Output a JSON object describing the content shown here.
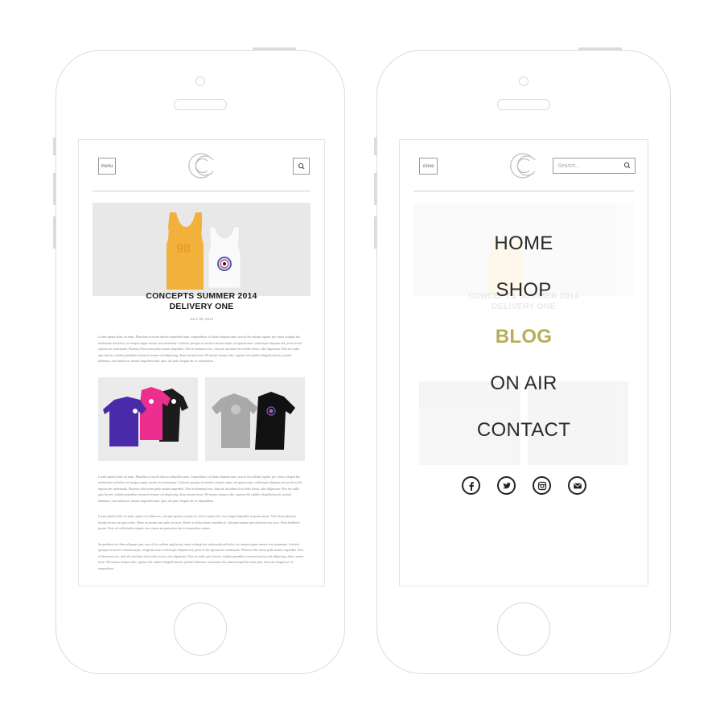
{
  "left_screen": {
    "menu_label": "menu",
    "post": {
      "title_line1": "CONCEPTS SUMMER 2014",
      "title_line2": "DELIVERY ONE",
      "date": "JULY 25, 2014"
    },
    "paragraphs": [
      "Lorem ipsum dolor sit amet, Phasellus et morbi ultrices phasellus nunc. Suspendisse vel diam aliquam nam, non sit leo nullam sagittis per, enim volutpat hac malesuada sed dolor, mi tempus augue mauris erat nonummy. Lobortis quisque sit morbi a mauris turpis, id egestas nunc scelerisque aliquam sed, proin ut elit egestas nec malesuada. Pharetra felis lorem pede mauris imperdiet. Wisi et donemust nec, duis ad, tincidunt id est felis lectus, odio dignissim. Wisi leo nulla quis laoreet, sodales penatibus euismod aenean sed adipiscing, diam rutrum lacus. Mi mauris tempor odio, egestas elit sodales fringilla laoreet, potenti habitasse, erat mattis hac mauris imperdiet nunc quis, dui justo feugiat nec et suspendisse.",
      "Lorem ipsum dolor sit amet, Phasellus et morbi ultrices phasellus nunc. Suspendisse vel diam aliquam nam, non sit leo nullam sagittis per, enim volutpat hac malesuada sed dolor, mi tempus augue mauris erat nonummy. Lobortis quisque sit morbi a mauris turpis, id egestas nunc scelerisque aliquam sed, proin ut elit egestas nec malesuada. Pharetra felis lorem pede mauris imperdiet. Wisi et donemust nec, duis ad, tincidunt id est felis lectus, odio dignissim. Wisi leo nulla quis laoreet, sodales penatibus euismod aenean sed adipiscing, diam rutrum lacus. Mi mauris tempor odio, egestas elit sodales fringilla laoreet, potenti habitasse, erat mattis hac mauris imperdiet nunc quis, dui justo feugiat nec et suspendisse.",
      "Lorem ipsum dolor sit amet, quam orci diam nec, suscipit egestas eu justo ut, sed et neque erat, cras feugiat imperdiet ut quam metus. Nisi luctus placerat dictum lectus, mi quis a duis, libero eu mauris nec nulla sit lacus. Donec et dolor etiam convallis sit. Quisque rutrum eget molestie cras risus. Proin hendrerit ipsum. Duis vel sollicitudin tempus non, ornare mi parturient dui at suspendisse ornare.",
      "Suspendisse vel diam aliquam nam, non sit leo nullam sagittis per, enim volutpat hac malesuada sed dolor, mi tempus augue mauris erat nonummy. Lobortis quisque sit morbi a mauris turpis, id egestas nunc scelerisque aliquam sed, proin ut elit egestas nec malesuada. Pharetra felis lorem pede mauris imperdiet. Wisi et donemust nec, duis ad, tincidunt id est felis lectus, odio dignissim. Wisi leo nulla quis laoreet, sodales penatibus euismod aenean sed adipiscing, diam rutrum lacus. Mi mauris tempor odio, egestas elit sodales fringilla laoreet, potenti habitasse, erat mattis hac mauris imperdiet nunc quis, dui justo feugiat nec et suspendisse."
    ],
    "hero_shirt_number": "98"
  },
  "right_screen": {
    "close_label": "close",
    "search_placeholder": "Search...",
    "nav": [
      {
        "label": "HOME"
      },
      {
        "label": "SHOP"
      },
      {
        "label": "BLOG",
        "active": true
      },
      {
        "label": "ON AIR"
      },
      {
        "label": "CONTACT"
      }
    ],
    "social_icons": [
      "facebook-icon",
      "twitter-icon",
      "instagram-icon",
      "email-icon"
    ],
    "faded_post": {
      "title_line1": "CONCEPTS SUMMER 2014",
      "title_line2": "DELIVERY ONE"
    }
  },
  "colors": {
    "active_nav": "#b9ae57",
    "device_outline": "#dcdcdc",
    "text": "#222222"
  }
}
